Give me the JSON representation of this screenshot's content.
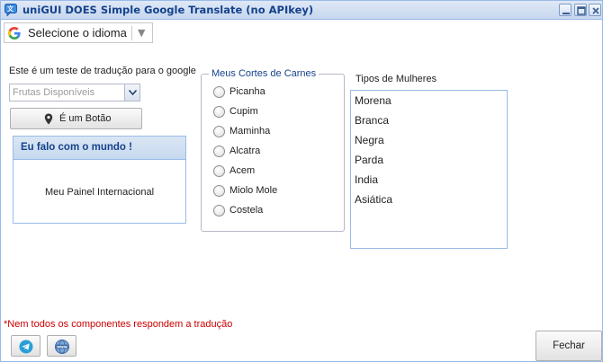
{
  "window": {
    "title": "uniGUI DOES Simple Google Translate (no APIkey)",
    "icon": "translate-icon",
    "tools": [
      "minimize-icon",
      "maximize-icon",
      "close-icon"
    ]
  },
  "language_selector": {
    "icon": "google-g-icon",
    "label": "Selecione o idioma"
  },
  "form": {
    "teste_label": "Este é um teste de tradução para o google",
    "combo_placeholder": "Frutas Disponíveis",
    "button_label": "É um Botão",
    "button_icon": "map-pin-icon"
  },
  "panel": {
    "title": "Eu falo com o mundo !",
    "body": "Meu Painel Internacional"
  },
  "radio_group": {
    "legend": "Meus Cortes de Carnes",
    "options": [
      "Picanha",
      "Cupim",
      "Maminha",
      "Alcatra",
      "Acem",
      "Miolo Mole",
      "Costela"
    ]
  },
  "list": {
    "label": "Tipos de Mulheres",
    "items": [
      "Morena",
      "Branca",
      "Negra",
      "Parda",
      "India",
      "Asiática"
    ]
  },
  "note": "*Nem todos os componentes respondem a tradução",
  "footer": {
    "telegram_icon": "telegram-icon",
    "web_icon": "www-globe-icon",
    "close_label": "Fechar"
  },
  "colors": {
    "accent": "#15428b",
    "border": "#99bbe8",
    "note": "#cc0000"
  }
}
